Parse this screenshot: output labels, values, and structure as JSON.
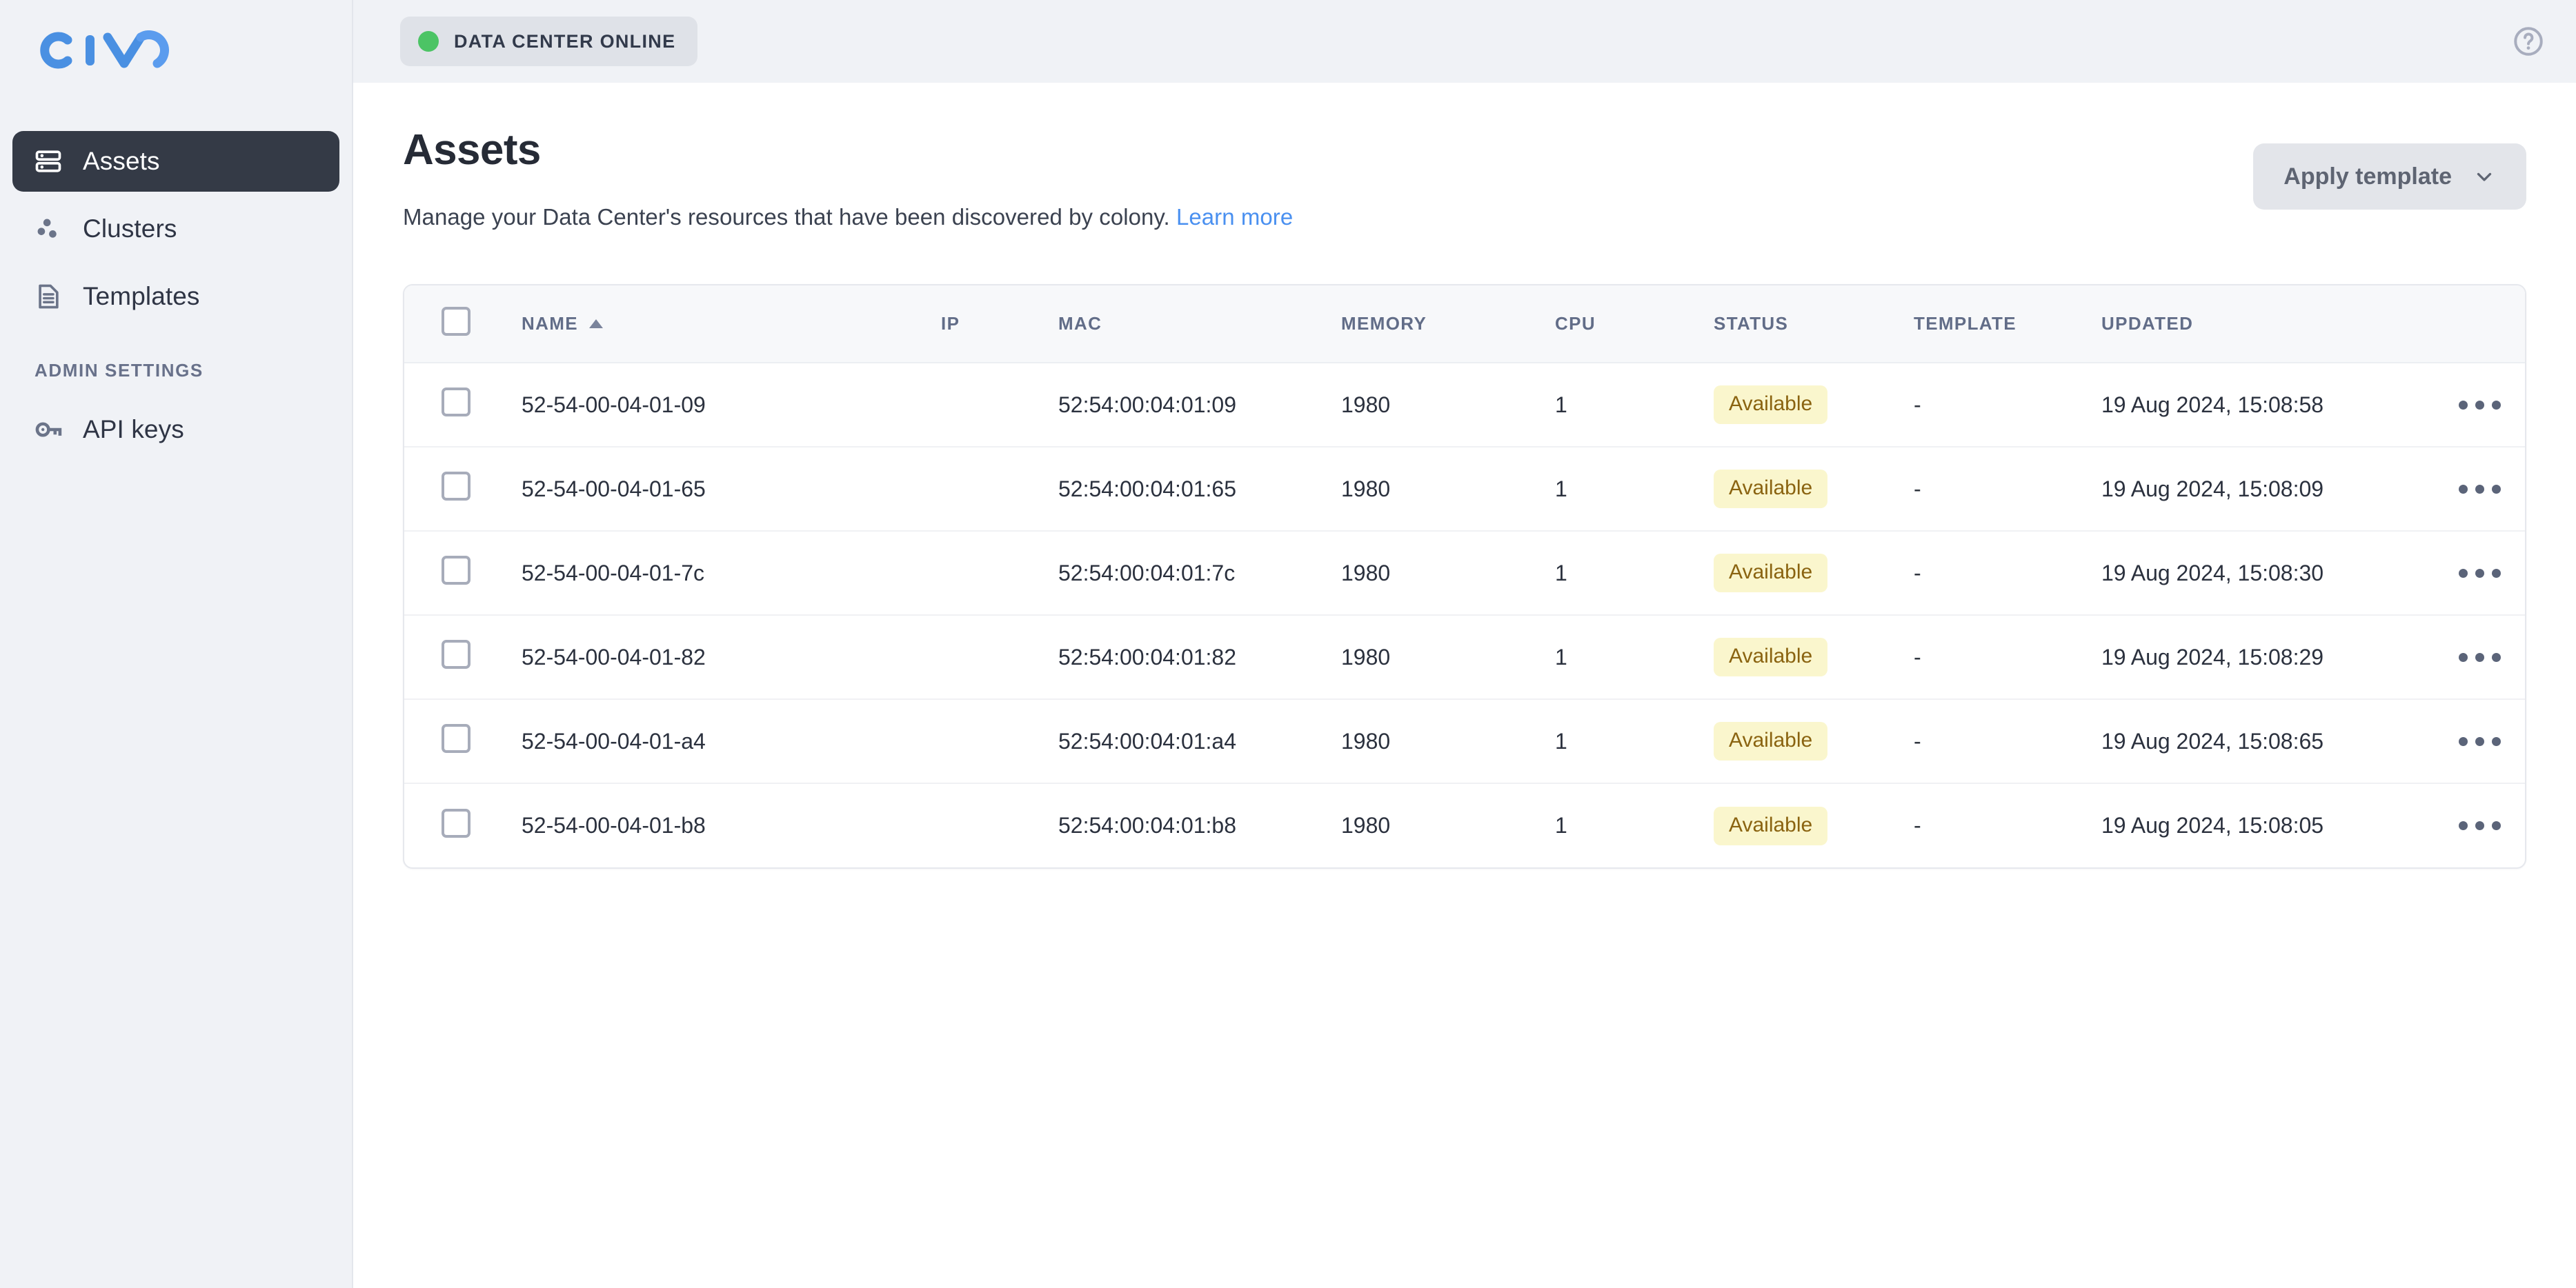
{
  "brand": {
    "name": "CIVO",
    "logo_color": "#4a90e2"
  },
  "sidebar": {
    "items": [
      {
        "id": "assets",
        "label": "Assets",
        "icon": "server-icon",
        "active": true
      },
      {
        "id": "clusters",
        "label": "Clusters",
        "icon": "clusters-icon",
        "active": false
      },
      {
        "id": "templates",
        "label": "Templates",
        "icon": "document-icon",
        "active": false
      }
    ],
    "section_title": "ADMIN SETTINGS",
    "admin_items": [
      {
        "id": "api-keys",
        "label": "API keys",
        "icon": "key-icon",
        "active": false
      }
    ]
  },
  "topbar": {
    "status_label": "DATA CENTER ONLINE",
    "status_color": "#4cc465",
    "help_icon": "help-circle-icon"
  },
  "page": {
    "title": "Assets",
    "description": "Manage your Data Center's resources that have been discovered by colony.",
    "learn_more": "Learn more",
    "apply_template_label": "Apply template"
  },
  "table": {
    "sort_column": "NAME",
    "sort_direction": "asc",
    "columns": [
      {
        "key": "name",
        "label": "NAME"
      },
      {
        "key": "ip",
        "label": "IP"
      },
      {
        "key": "mac",
        "label": "MAC"
      },
      {
        "key": "memory",
        "label": "MEMORY"
      },
      {
        "key": "cpu",
        "label": "CPU"
      },
      {
        "key": "status",
        "label": "STATUS"
      },
      {
        "key": "template",
        "label": "TEMPLATE"
      },
      {
        "key": "updated",
        "label": "UPDATED"
      }
    ],
    "rows": [
      {
        "name": "52-54-00-04-01-09",
        "ip": "",
        "mac": "52:54:00:04:01:09",
        "memory": "1980",
        "cpu": "1",
        "status": "Available",
        "template": "-",
        "updated": "19 Aug 2024, 15:08:58"
      },
      {
        "name": "52-54-00-04-01-65",
        "ip": "",
        "mac": "52:54:00:04:01:65",
        "memory": "1980",
        "cpu": "1",
        "status": "Available",
        "template": "-",
        "updated": "19 Aug 2024, 15:08:09"
      },
      {
        "name": "52-54-00-04-01-7c",
        "ip": "",
        "mac": "52:54:00:04:01:7c",
        "memory": "1980",
        "cpu": "1",
        "status": "Available",
        "template": "-",
        "updated": "19 Aug 2024, 15:08:30"
      },
      {
        "name": "52-54-00-04-01-82",
        "ip": "",
        "mac": "52:54:00:04:01:82",
        "memory": "1980",
        "cpu": "1",
        "status": "Available",
        "template": "-",
        "updated": "19 Aug 2024, 15:08:29"
      },
      {
        "name": "52-54-00-04-01-a4",
        "ip": "",
        "mac": "52:54:00:04:01:a4",
        "memory": "1980",
        "cpu": "1",
        "status": "Available",
        "template": "-",
        "updated": "19 Aug 2024, 15:08:65"
      },
      {
        "name": "52-54-00-04-01-b8",
        "ip": "",
        "mac": "52:54:00:04:01:b8",
        "memory": "1980",
        "cpu": "1",
        "status": "Available",
        "template": "-",
        "updated": "19 Aug 2024, 15:08:05"
      }
    ]
  },
  "colors": {
    "sidebar_bg": "#f0f2f6",
    "active_nav_bg": "#343a46",
    "badge_bg": "#faf6cd",
    "badge_text": "#8a6310",
    "link": "#4a90f0"
  }
}
